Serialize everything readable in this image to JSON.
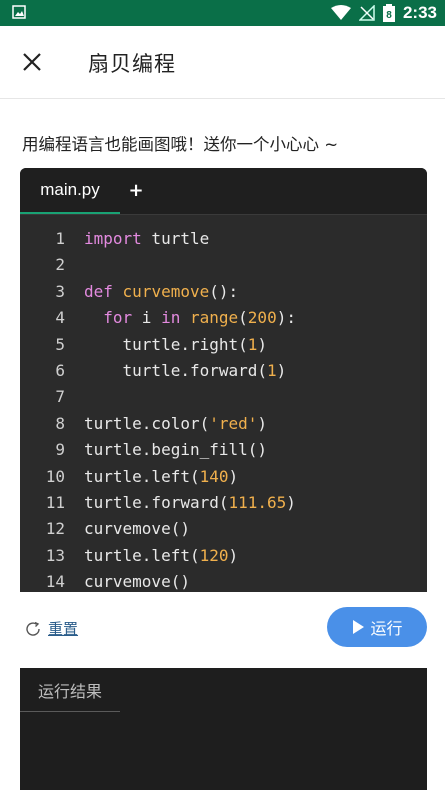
{
  "status_bar": {
    "time": "2:33",
    "battery": "8"
  },
  "app_bar": {
    "title": "扇贝编程"
  },
  "prompt": "用编程语言也能画图哦！送你一个小心心 ~",
  "editor": {
    "tab_label": "main.py",
    "add_tab": "+",
    "lines": [
      {
        "n": "1",
        "tokens": [
          [
            "kw",
            "import"
          ],
          [
            "p",
            " turtle"
          ]
        ]
      },
      {
        "n": "2",
        "tokens": []
      },
      {
        "n": "3",
        "tokens": [
          [
            "kw",
            "def"
          ],
          [
            "p",
            " "
          ],
          [
            "fn",
            "curvemove"
          ],
          [
            "p",
            "():"
          ]
        ]
      },
      {
        "n": "4",
        "tokens": [
          [
            "p",
            "  "
          ],
          [
            "kw",
            "for"
          ],
          [
            "p",
            " i "
          ],
          [
            "kw",
            "in"
          ],
          [
            "p",
            " "
          ],
          [
            "fn",
            "range"
          ],
          [
            "p",
            "("
          ],
          [
            "num",
            "200"
          ],
          [
            "p",
            "):"
          ]
        ]
      },
      {
        "n": "5",
        "tokens": [
          [
            "p",
            "    turtle.right("
          ],
          [
            "num",
            "1"
          ],
          [
            "p",
            ")"
          ]
        ]
      },
      {
        "n": "6",
        "tokens": [
          [
            "p",
            "    turtle.forward("
          ],
          [
            "num",
            "1"
          ],
          [
            "p",
            ")"
          ]
        ]
      },
      {
        "n": "7",
        "tokens": []
      },
      {
        "n": "8",
        "tokens": [
          [
            "p",
            "turtle.color("
          ],
          [
            "str",
            "'red'"
          ],
          [
            "p",
            ")"
          ]
        ]
      },
      {
        "n": "9",
        "tokens": [
          [
            "p",
            "turtle.begin_fill()"
          ]
        ]
      },
      {
        "n": "10",
        "tokens": [
          [
            "p",
            "turtle.left("
          ],
          [
            "num",
            "140"
          ],
          [
            "p",
            ")"
          ]
        ]
      },
      {
        "n": "11",
        "tokens": [
          [
            "p",
            "turtle.forward("
          ],
          [
            "num",
            "111.65"
          ],
          [
            "p",
            ")"
          ]
        ]
      },
      {
        "n": "12",
        "tokens": [
          [
            "p",
            "curvemove()"
          ]
        ]
      },
      {
        "n": "13",
        "tokens": [
          [
            "p",
            "turtle.left("
          ],
          [
            "num",
            "120"
          ],
          [
            "p",
            ")"
          ]
        ]
      },
      {
        "n": "14",
        "tokens": [
          [
            "p",
            "curvemove()"
          ]
        ]
      }
    ]
  },
  "controls": {
    "reset_label": "重置",
    "run_label": "运行"
  },
  "result": {
    "tab_label": "运行结果"
  },
  "colors": {
    "accent_green": "#0a6f48",
    "run_blue": "#4a90e8",
    "tab_underline": "#19a274"
  },
  "icons": {
    "close": "close-icon",
    "reset": "refresh-icon",
    "run": "play-icon"
  }
}
